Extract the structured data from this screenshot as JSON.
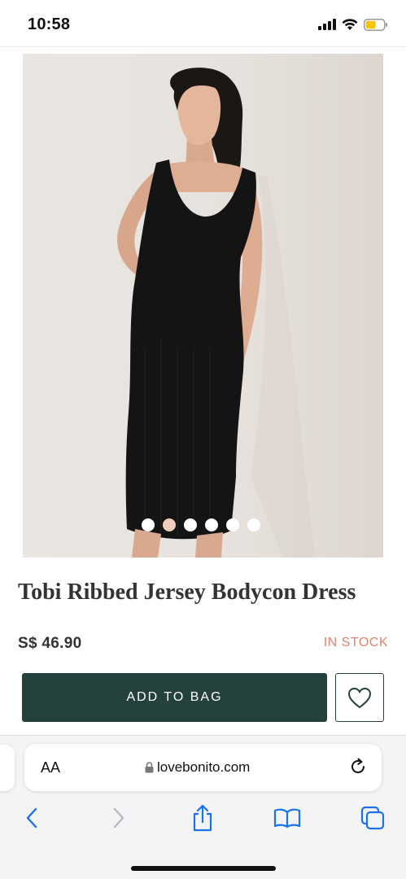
{
  "status": {
    "time": "10:58",
    "battery_color": "#f5c40f"
  },
  "carousel": {
    "slide_count": 6,
    "active_index": 1,
    "active_color": "#f2cdbd"
  },
  "product": {
    "title": "Tobi Ribbed Jersey Bodycon Dress",
    "price": "S$ 46.90",
    "stock_status": "IN STOCK",
    "stock_color": "#e0846f"
  },
  "actions": {
    "add_to_bag_label": "ADD TO BAG",
    "button_color": "#25413e",
    "wishlist_icon": "heart-icon"
  },
  "browser": {
    "text_size_label": "AA",
    "url": "lovebonito.com",
    "tint_color": "#1a73e8"
  }
}
